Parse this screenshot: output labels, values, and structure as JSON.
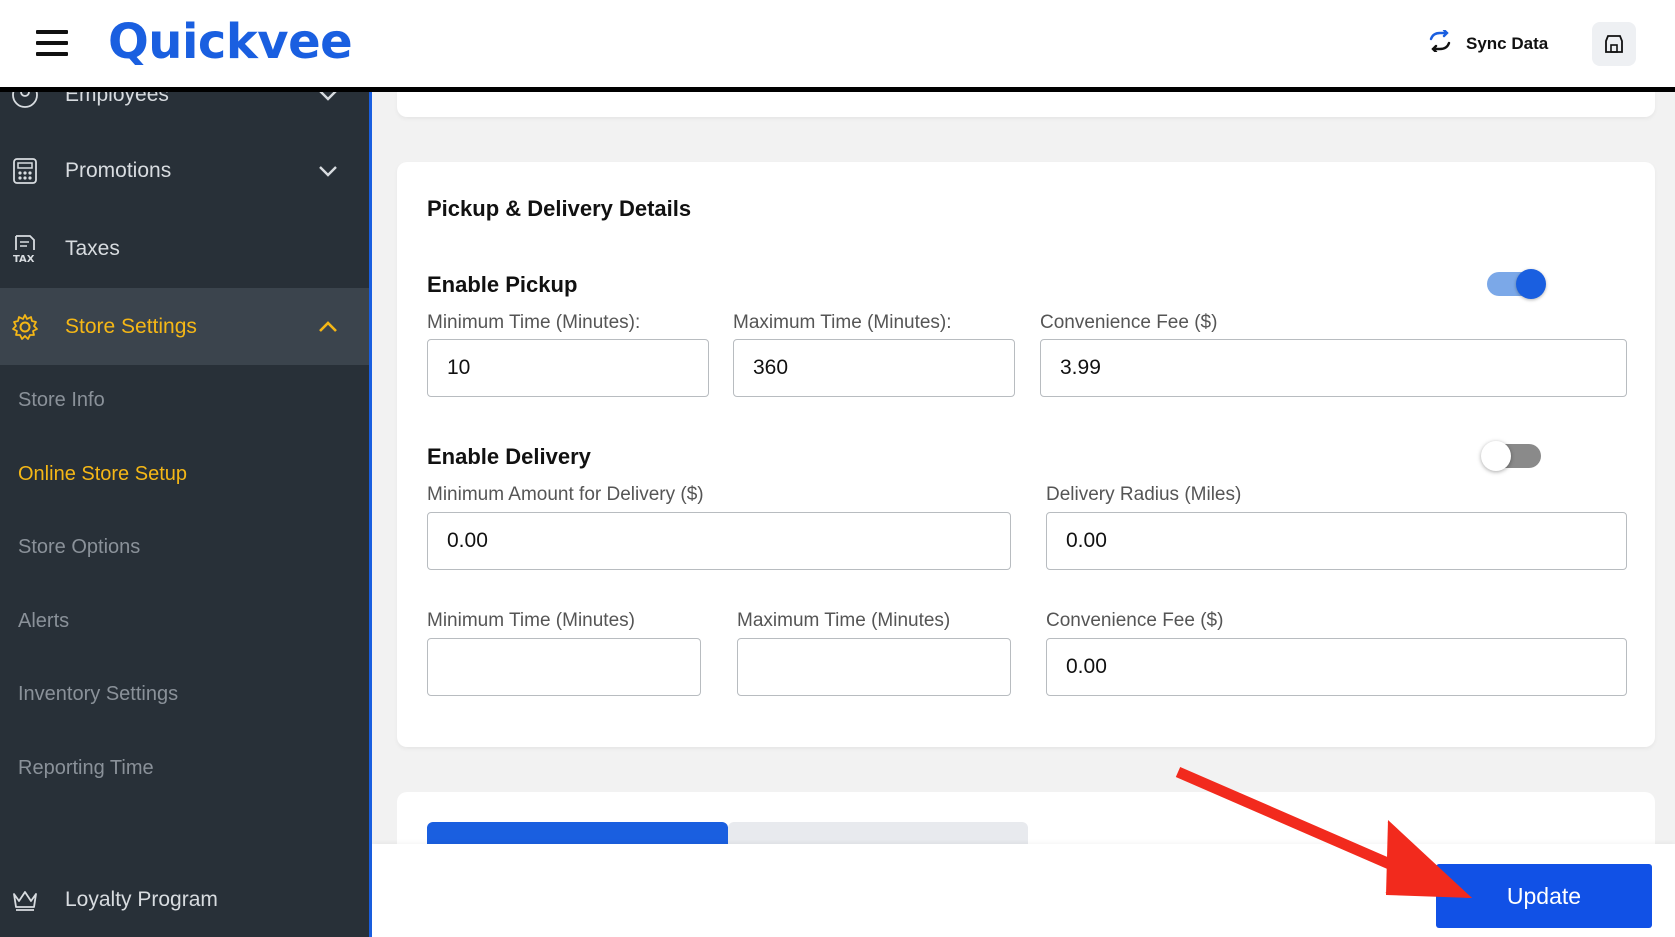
{
  "header": {
    "logo": "Quickvee",
    "sync_label": "Sync Data"
  },
  "sidebar": {
    "items": [
      {
        "label": "Employees",
        "icon": "user-circle-icon"
      },
      {
        "label": "Promotions",
        "icon": "calculator-icon"
      },
      {
        "label": "Taxes",
        "icon": "tax-receipt-icon"
      },
      {
        "label": "Store Settings",
        "icon": "gear-icon"
      },
      {
        "label": "Loyalty Program",
        "icon": "crown-icon"
      }
    ],
    "sub_items": [
      "Store Info",
      "Online Store Setup",
      "Store Options",
      "Alerts",
      "Inventory Settings",
      "Reporting Time"
    ]
  },
  "card": {
    "title": "Pickup & Delivery Details",
    "pickup": {
      "title": "Enable Pickup",
      "enabled": true,
      "min_time_label": "Minimum Time (Minutes):",
      "min_time_value": "10",
      "max_time_label": "Maximum Time (Minutes):",
      "max_time_value": "360",
      "fee_label": "Convenience Fee ($)",
      "fee_value": "3.99"
    },
    "delivery": {
      "title": "Enable Delivery",
      "enabled": false,
      "min_amount_label": "Minimum Amount for Delivery ($)",
      "min_amount_value": "0.00",
      "radius_label": "Delivery Radius (Miles)",
      "radius_value": "0.00",
      "min_time_label": "Minimum Time (Minutes)",
      "min_time_value": "",
      "max_time_label": "Maximum Time (Minutes)",
      "max_time_value": "",
      "fee_label": "Convenience Fee ($)",
      "fee_value": "0.00"
    }
  },
  "footer": {
    "update_label": "Update"
  },
  "colors": {
    "brand": "#1a5fe0",
    "sidebar_bg": "#283038",
    "active_accent": "#f5b716",
    "annotation_arrow": "#f22a1d"
  }
}
